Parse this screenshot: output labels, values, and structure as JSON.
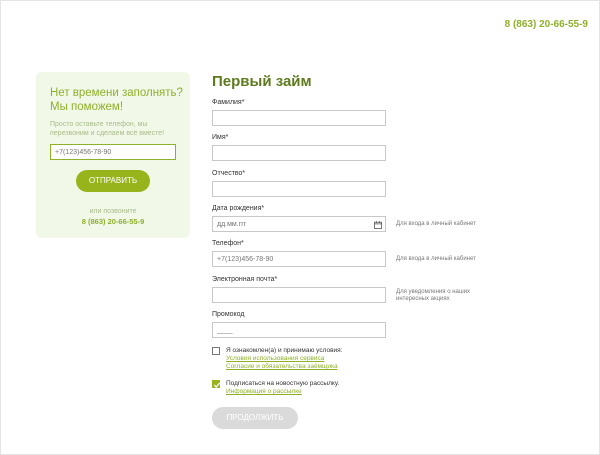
{
  "header": {
    "phone": "8 (863) 20-66-55-9"
  },
  "callback": {
    "title": "Нет времени заполнять? Мы поможем!",
    "description": "Просто оставьте телефон, мы перезвоним и сделаем всё вместе!",
    "phone_placeholder": "+7(123)456-78-90",
    "button_label": "ОТПРАВИТЬ",
    "or_call_text": "или позвоните",
    "phone": "8 (863) 20-66-55-9"
  },
  "form": {
    "title": "Первый займ",
    "fields": {
      "last_name": {
        "label": "Фамилия*",
        "value": ""
      },
      "first_name": {
        "label": "Имя*",
        "value": ""
      },
      "middle_name": {
        "label": "Отчество*",
        "value": ""
      },
      "birth_date": {
        "label": "Дата рождения*",
        "placeholder": "дд.мм.ггг",
        "hint": "Для входа в личный кабинет"
      },
      "phone": {
        "label": "Телефон*",
        "placeholder": "+7(123)456-78-90",
        "hint": "Для входа в личный кабинет"
      },
      "email": {
        "label": "Электронная почта*",
        "value": "",
        "hint": "Для уведомления о наших интересных акциях"
      },
      "promo": {
        "label": "Промокод",
        "placeholder": "____"
      }
    },
    "consent": {
      "checked": false,
      "text": "Я ознакомлен(а) и принимаю условия:",
      "link1": "Условия использования сервиса",
      "link2": "Согласие и обязательства заёмщика"
    },
    "newsletter": {
      "checked": true,
      "text": "Подписаться на новостную рассылку.",
      "link": "Информация о рассылке"
    },
    "submit_label": "ПРОДОЛЖИТЬ"
  },
  "colors": {
    "accent": "#98b41d",
    "accent_text": "#8fb02a",
    "panel_bg": "#f1f8e8",
    "disabled": "#dadada"
  }
}
